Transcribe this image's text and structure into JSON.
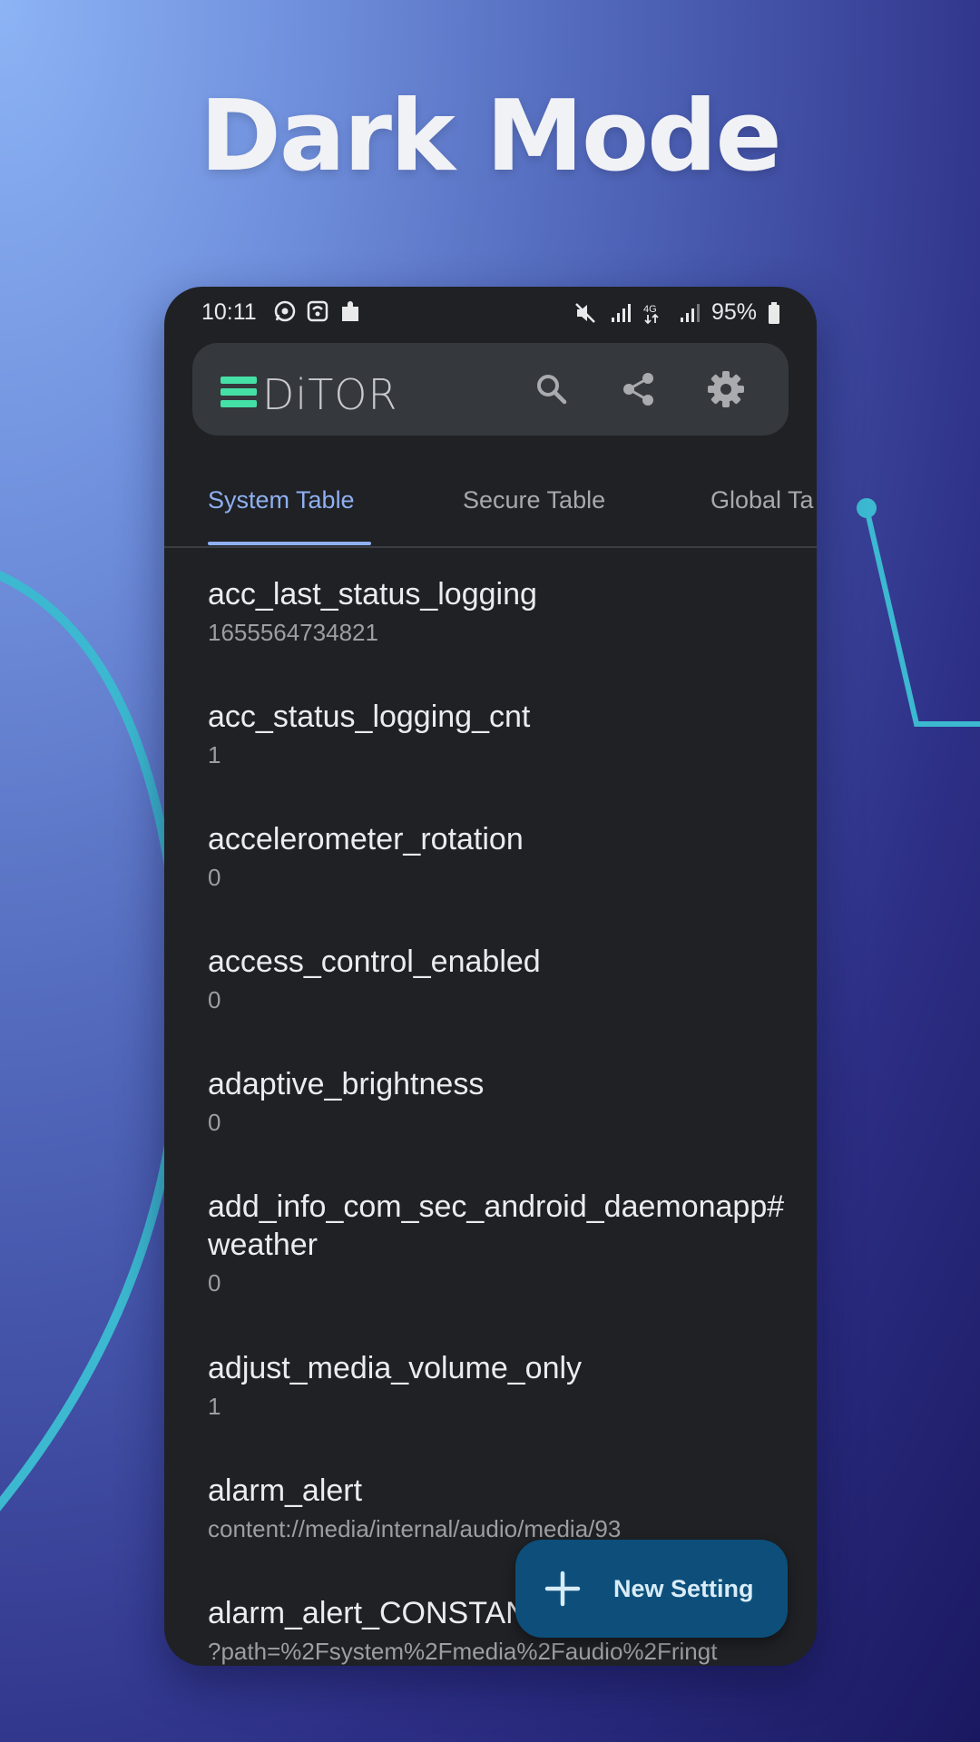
{
  "headline": "Dark Mode",
  "status_bar": {
    "time": "10:11",
    "battery": "95%",
    "left_icons": [
      "whatsapp-icon",
      "wifi-calling-icon",
      "puzzle-icon"
    ],
    "right_icons": [
      "mute-icon",
      "signal-icon",
      "4g-icon",
      "signal-icon"
    ]
  },
  "toolbar": {
    "logo_text": "DiTOR",
    "actions": [
      "search-icon",
      "share-icon",
      "gear-icon"
    ]
  },
  "tabs": [
    {
      "label": "System Table",
      "active": true
    },
    {
      "label": "Secure Table",
      "active": false
    },
    {
      "label": "Global Ta",
      "active": false
    }
  ],
  "settings": [
    {
      "name": "acc_last_status_logging",
      "value": "1655564734821"
    },
    {
      "name": "acc_status_logging_cnt",
      "value": "1"
    },
    {
      "name": "accelerometer_rotation",
      "value": "0"
    },
    {
      "name": "access_control_enabled",
      "value": "0"
    },
    {
      "name": "adaptive_brightness",
      "value": "0"
    },
    {
      "name": "add_info_com_sec_android_daemonapp#weather",
      "value": "0"
    },
    {
      "name": "adjust_media_volume_only",
      "value": "1"
    },
    {
      "name": "alarm_alert",
      "value": "content://media/internal/audio/media/93"
    },
    {
      "name": "alarm_alert_CONSTANT",
      "value": "?path=%2Fsystem%2Fmedia%2Faudio%2Fringt"
    }
  ],
  "fab": {
    "label": "New Setting"
  },
  "colors": {
    "accent": "#8fb0f0",
    "logo": "#45e0a6",
    "fab": "#0d4f7a",
    "surface": "#1f2125",
    "deco": "#3cb8d0"
  }
}
